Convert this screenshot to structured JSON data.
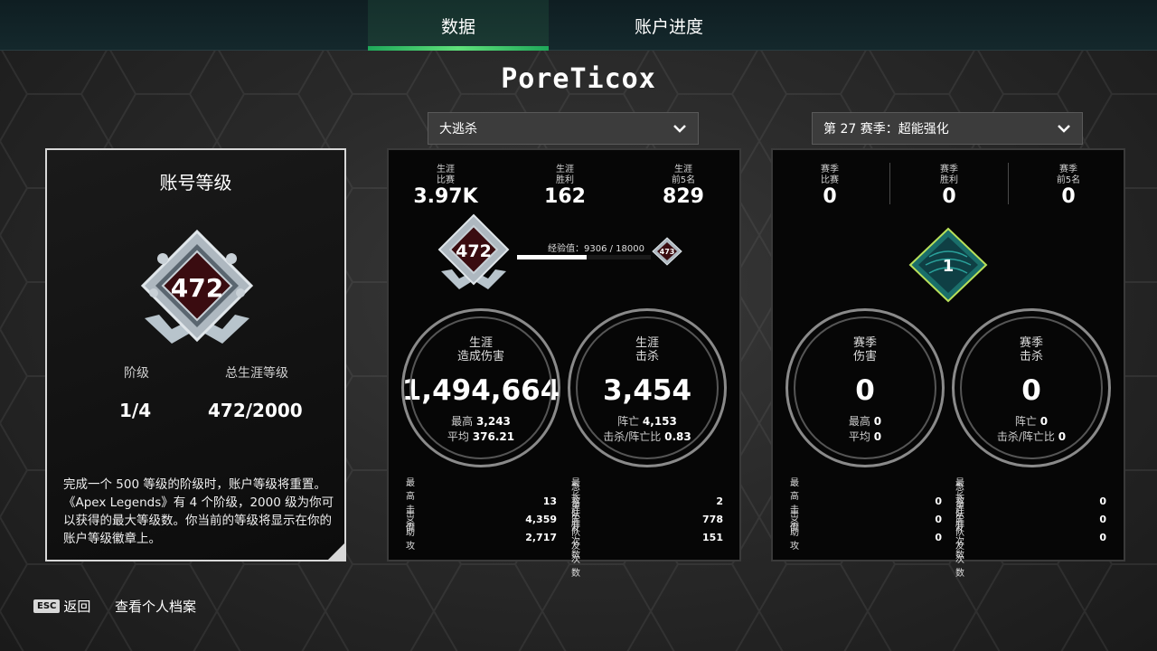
{
  "tabs": [
    {
      "label": "数据"
    },
    {
      "label": "账户进度"
    }
  ],
  "player_name": "PoreTicox",
  "mode_dropdown": {
    "value": "大逃杀"
  },
  "season_dropdown": {
    "value": "第 27 赛季：超能强化"
  },
  "account_level": {
    "title": "账号等级",
    "badge_level": "472",
    "stage_label": "阶级",
    "stage_value": "1/4",
    "total_label": "总生涯等级",
    "total_value": "472/2000",
    "description": "完成一个 500 等级的阶级时，账户等级将重置。《Apex Legends》有 4 个阶级，2000 级为你可以获得的最大等级数。你当前的等级将显示在你的账户等级徽章上。"
  },
  "career": {
    "top": [
      {
        "label1": "生涯",
        "label2": "比赛",
        "value": "3.97K"
      },
      {
        "label1": "生涯",
        "label2": "胜利",
        "value": "162"
      },
      {
        "label1": "生涯",
        "label2": "前5名",
        "value": "829"
      }
    ],
    "current_level": "472",
    "next_level": "473",
    "xp_label": "经验值：",
    "xp_text": "9306 / 18000",
    "xp_progress": 0.517,
    "damage": {
      "title1": "生涯",
      "title2": "造成伤害",
      "value": "1,494,664",
      "sub1_label": "最高",
      "sub1_value": "3,243",
      "sub2_label": "平均",
      "sub2_value": "376.21"
    },
    "kills": {
      "title1": "生涯",
      "title2": "击杀",
      "value": "3,454",
      "sub1_label": "阵亡",
      "sub1_value": "4,153",
      "sub2_label": "击杀/阵亡比",
      "sub2_value": "0.83"
    },
    "stats_left": [
      {
        "label": "最高击杀",
        "value": "13"
      },
      {
        "label": "击倒",
        "value": "4,359"
      },
      {
        "label": "助攻",
        "value": "2,717"
      }
    ],
    "stats_right": [
      {
        "label": "最长连胜",
        "value": "2"
      },
      {
        "label": "急救队友次数",
        "value": "778"
      },
      {
        "label": "重生队友次数",
        "value": "151"
      }
    ]
  },
  "season": {
    "top": [
      {
        "label1": "赛季",
        "label2": "比赛",
        "value": "0"
      },
      {
        "label1": "赛季",
        "label2": "胜利",
        "value": "0"
      },
      {
        "label1": "赛季",
        "label2": "前5名",
        "value": "0"
      }
    ],
    "badge_level": "1",
    "damage": {
      "title1": "赛季",
      "title2": "伤害",
      "value": "0",
      "sub1_label": "最高",
      "sub1_value": "0",
      "sub2_label": "平均",
      "sub2_value": "0"
    },
    "kills": {
      "title1": "赛季",
      "title2": "击杀",
      "value": "0",
      "sub1_label": "阵亡",
      "sub1_value": "0",
      "sub2_label": "击杀/阵亡比",
      "sub2_value": "0"
    },
    "stats_left": [
      {
        "label": "最高击杀",
        "value": "0"
      },
      {
        "label": "击倒",
        "value": "0"
      },
      {
        "label": "助攻",
        "value": "0"
      }
    ],
    "stats_right": [
      {
        "label": "最长连胜",
        "value": "0"
      },
      {
        "label": "急救队友次数",
        "value": "0"
      },
      {
        "label": "重生队友次数",
        "value": "0"
      }
    ]
  },
  "footer": {
    "esc_key": "ESC",
    "back_label": "返回",
    "profile_label": "查看个人档案"
  }
}
